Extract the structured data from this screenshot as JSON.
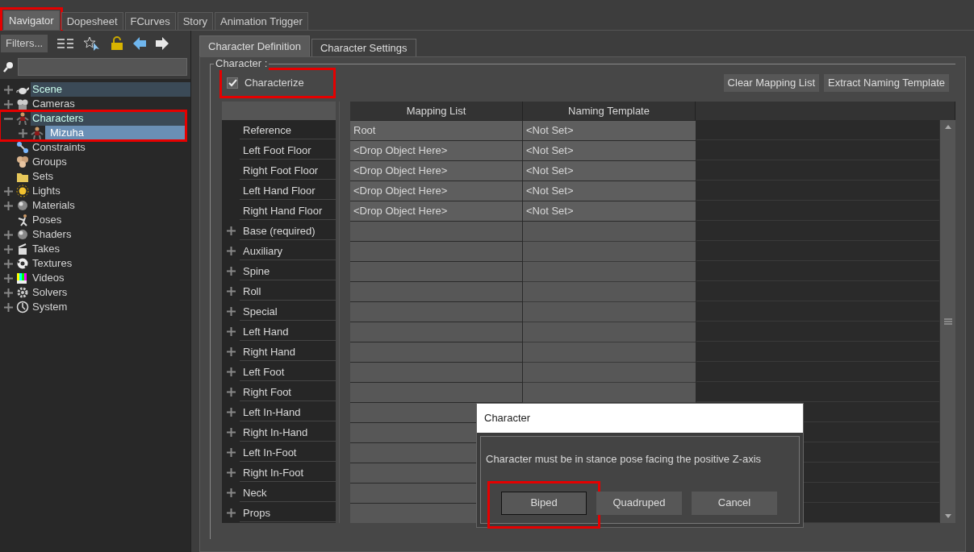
{
  "top_tabs": [
    {
      "label": "Navigator",
      "selected": true,
      "highlight": true
    },
    {
      "label": "Dopesheet",
      "selected": false
    },
    {
      "label": "FCurves",
      "selected": false
    },
    {
      "label": "Story",
      "selected": false
    },
    {
      "label": "Animation Trigger",
      "selected": false
    }
  ],
  "navigator": {
    "filters_button": "Filters...",
    "tree": [
      {
        "label": "Scene",
        "expanded": false,
        "active": true,
        "selected": false
      },
      {
        "label": "Cameras",
        "expanded": false,
        "active": false,
        "selected": false
      },
      {
        "label": "Characters",
        "expanded": true,
        "active": true,
        "selected": false,
        "highlight": true,
        "children": [
          {
            "label": "Mizuha",
            "expanded": false,
            "selected": true
          }
        ]
      },
      {
        "label": "Constraints",
        "active": false,
        "selected": false
      },
      {
        "label": "Groups",
        "active": false,
        "selected": false
      },
      {
        "label": "Sets",
        "active": false,
        "selected": false
      },
      {
        "label": "Lights",
        "expanded": false,
        "active": false,
        "selected": false
      },
      {
        "label": "Materials",
        "expanded": false,
        "active": false,
        "selected": false
      },
      {
        "label": "Poses",
        "active": false,
        "selected": false
      },
      {
        "label": "Shaders",
        "expanded": false,
        "active": false,
        "selected": false
      },
      {
        "label": "Takes",
        "expanded": false,
        "active": false,
        "selected": false
      },
      {
        "label": "Textures",
        "expanded": false,
        "active": false,
        "selected": false
      },
      {
        "label": "Videos",
        "expanded": false,
        "active": false,
        "selected": false
      },
      {
        "label": "Solvers",
        "expanded": false,
        "active": false,
        "selected": false
      },
      {
        "label": "System",
        "expanded": false,
        "active": false,
        "selected": false
      }
    ]
  },
  "sub_tabs": [
    {
      "label": "Character Definition",
      "selected": true
    },
    {
      "label": "Character Settings",
      "selected": false
    }
  ],
  "character_group": {
    "title": "Character :",
    "characterize": {
      "label": "Characterize",
      "checked": true,
      "highlight": true
    },
    "buttons": [
      "Clear Mapping List",
      "Extract Naming Template"
    ],
    "table": {
      "columns": [
        "Mapping List",
        "Naming Template"
      ],
      "rows": [
        {
          "kind": "slot",
          "name": "Reference",
          "mapping": "Root",
          "template": "<Not Set>"
        },
        {
          "kind": "slot",
          "name": "Left Foot Floor",
          "mapping": "<Drop Object Here>",
          "template": "<Not Set>"
        },
        {
          "kind": "slot",
          "name": "Right Foot Floor",
          "mapping": "<Drop Object Here>",
          "template": "<Not Set>"
        },
        {
          "kind": "slot",
          "name": "Left Hand Floor",
          "mapping": "<Drop Object Here>",
          "template": "<Not Set>"
        },
        {
          "kind": "slot",
          "name": "Right Hand Floor",
          "mapping": "<Drop Object Here>",
          "template": "<Not Set>"
        },
        {
          "kind": "group",
          "name": "Base (required)"
        },
        {
          "kind": "group",
          "name": "Auxiliary"
        },
        {
          "kind": "group",
          "name": "Spine"
        },
        {
          "kind": "group",
          "name": "Roll"
        },
        {
          "kind": "group",
          "name": "Special"
        },
        {
          "kind": "group",
          "name": "Left Hand"
        },
        {
          "kind": "group",
          "name": "Right Hand"
        },
        {
          "kind": "group",
          "name": "Left Foot"
        },
        {
          "kind": "group",
          "name": "Right Foot"
        },
        {
          "kind": "group",
          "name": "Left In-Hand"
        },
        {
          "kind": "group",
          "name": "Right In-Hand"
        },
        {
          "kind": "group",
          "name": "Left In-Foot"
        },
        {
          "kind": "group",
          "name": "Right In-Foot"
        },
        {
          "kind": "group",
          "name": "Neck"
        },
        {
          "kind": "group",
          "name": "Props"
        }
      ]
    }
  },
  "dialog": {
    "title": "Character",
    "message": "Character must be in stance pose facing the positive Z-axis",
    "buttons": [
      {
        "label": "Biped",
        "focused": true,
        "highlight": true
      },
      {
        "label": "Quadruped",
        "focused": false
      },
      {
        "label": "Cancel",
        "focused": false
      }
    ]
  }
}
